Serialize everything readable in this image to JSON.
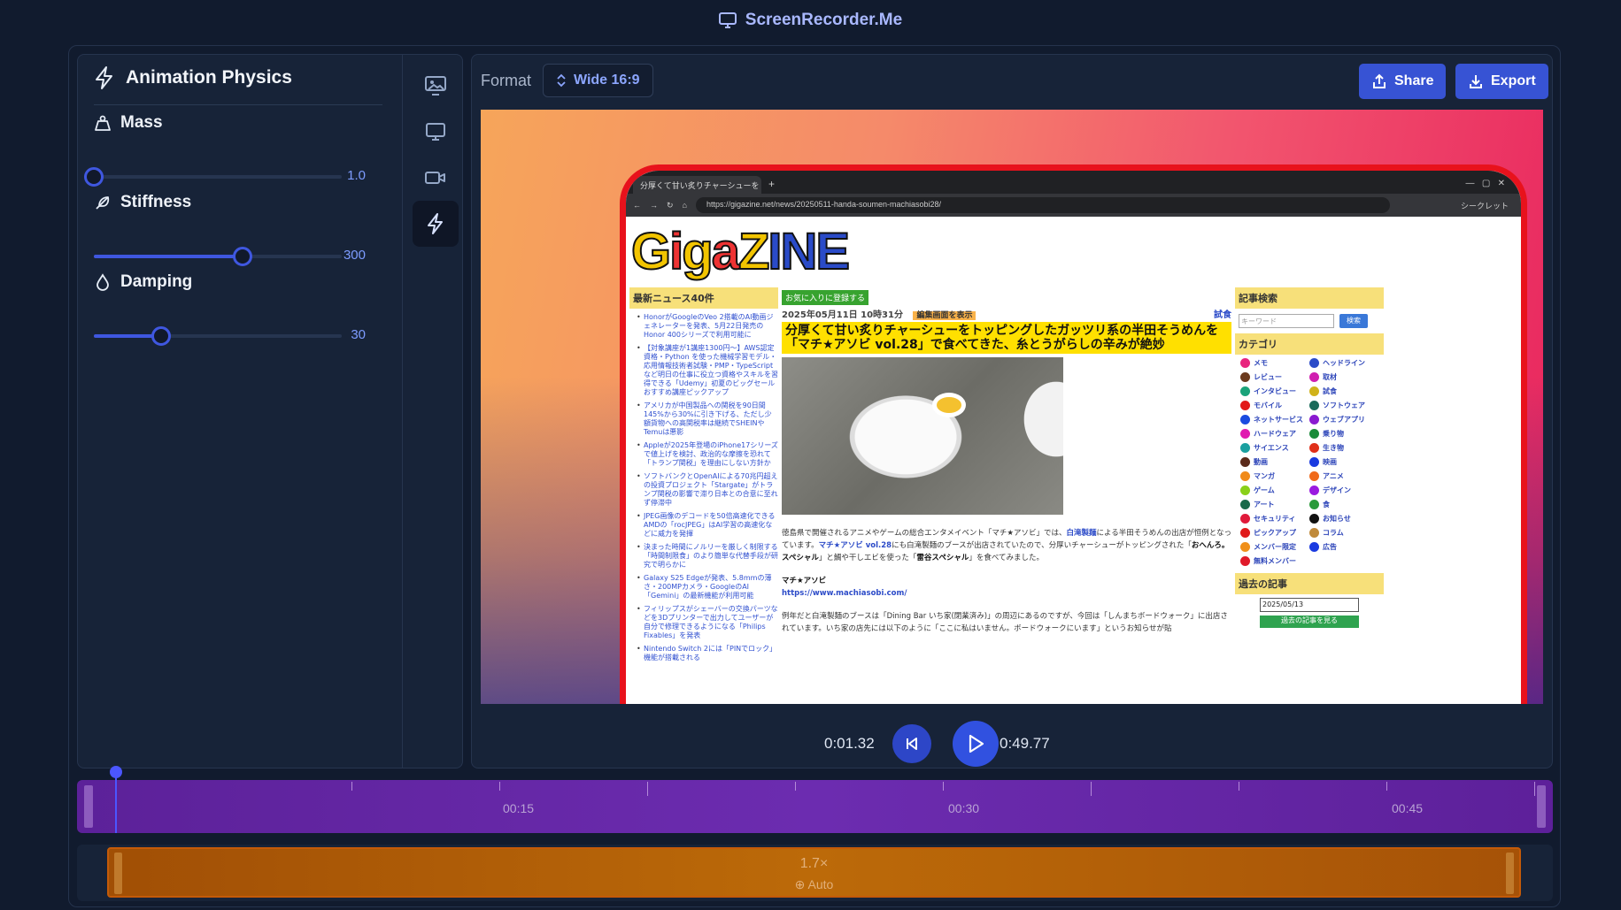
{
  "app": {
    "title": "ScreenRecorder.Me"
  },
  "left_panel": {
    "title": "Animation Physics",
    "params": [
      {
        "label": "Mass",
        "value": "1.0",
        "fraction": 0.0
      },
      {
        "label": "Stiffness",
        "value": "300",
        "fraction": 0.6
      },
      {
        "label": "Damping",
        "value": "30",
        "fraction": 0.27
      }
    ]
  },
  "rail": {
    "icons": [
      "image-settings-icon",
      "monitor-icon",
      "video-icon",
      "lightning-icon"
    ],
    "active": "lightning-icon"
  },
  "toolbar": {
    "format_label": "Format",
    "format_value": "Wide 16:9",
    "share_label": "Share",
    "export_label": "Export"
  },
  "browser": {
    "tab_title": "分厚くて甘い炙りチャーシューをトッピ",
    "url": "https://gigazine.net/news/20250511-handa-soumen-machiasobi28/",
    "incognito": "シークレット"
  },
  "site": {
    "logo": "GIGAZINE",
    "left_box": "最新ニュース40件",
    "news": [
      "HonorがGoogleのVeo 2搭載のAI動画ジェネレーターを発表、5月22日発売のHonor 400シリーズで利用可能に",
      "【対象講座が1講座1300円〜】AWS認定資格・Python を使った機械学習モデル・応用情報技術者試験・PMP・TypeScriptなど明日の仕事に役立つ資格やスキルを習得できる「Udemy」初夏のビッグセールおすすめ講座ピックアップ",
      "アメリカが中国製品への関税を90日間145%から30%に引き下げる、ただし少額貨物への高関税率は継続でSHEINやTemuは悪影",
      "Appleが2025年登場のiPhone17シリーズで値上げを検討、政治的な摩擦を恐れて「トランプ関税」を理由にしない方針か",
      "ソフトバンクとOpenAIによる70兆円超えの投資プロジェクト「Stargate」がトランプ関税の影響で滞り日本との合意に至れず停滞中",
      "JPEG画像のデコードを50倍高速化できるAMDの「rocJPEG」はAI学習の高速化などに威力を発揮",
      "決まった時間にノルリーを厳しく制限する「時間制限食」のより簡単な代替手段が研究で明らかに",
      "Galaxy S25 Edgeが発表、5.8mmの薄さ・200MPカメラ・GoogleのAI「Gemini」の最新機能が利用可能",
      "フィリップスがシェーバーの交換パーツなどを3Dプリンターで出力してユーザーが自分で修理できるようになる「Philips Fixables」を発表",
      "Nintendo Switch 2には「PINでロック」機能が搭載される"
    ],
    "fav_label": "お気に入りに登録する",
    "date": "2025年05月11日 10時31分",
    "edit_label": "編集画面を表示",
    "tag": "試食",
    "headline": "分厚くて甘い炙りチャーシューをトッピングしたガッツリ系の半田そうめんを「マチ★アソビ vol.28」で食べてきた、糸とうがらしの辛みが絶妙",
    "para1_a": "徳島県で開催されるアニメやゲームの総合エンタメイベント「マチ★アソビ」では、",
    "para1_link": "白滝製麺",
    "para1_b": "による半田そうめんの出店が恒例となっています。",
    "para1_link2": "マチ★アソビ vol.28",
    "para1_c": "にも白滝製麺のブースが出店されていたので、分厚いチャーシューがトッピングされた「",
    "para1_bold1": "おへんろ。スペシャル",
    "para1_d": "」と鯛や干しエビを使った「",
    "para1_bold2": "雷谷スペシャル",
    "para1_e": "」を食べてみました。",
    "site_name": "マチ★アソビ",
    "site_url": "https://www.machiasobi.com/",
    "para2": "例年だと白滝製麺のブースは「Dining Bar いち家(閉業済み)」の周辺にあるのですが、今回は「しんまちボードウォーク」に出店されています。いち家の店先には以下のように「ここに私はいません。ボードウォークにいます」というお知らせが貼",
    "search_title": "記事検索",
    "search_placeholder": "キーワード",
    "search_btn": "検索",
    "cat_title": "カテゴリ",
    "categories": [
      {
        "name": "メモ",
        "color": "#e8247e"
      },
      {
        "name": "ヘッドライン",
        "color": "#2b4bc8"
      },
      {
        "name": "レビュー",
        "color": "#6b3a1e"
      },
      {
        "name": "取材",
        "color": "#d01fb0"
      },
      {
        "name": "インタビュー",
        "color": "#1aa37a"
      },
      {
        "name": "試食",
        "color": "#d0b21a"
      },
      {
        "name": "モバイル",
        "color": "#e21a1a"
      },
      {
        "name": "ソフトウェア",
        "color": "#1a6a5a"
      },
      {
        "name": "ネットサービス",
        "color": "#1a4be0"
      },
      {
        "name": "ウェブアプリ",
        "color": "#8a1ad0"
      },
      {
        "name": "ハードウェア",
        "color": "#e01ab0"
      },
      {
        "name": "乗り物",
        "color": "#1a8a3a"
      },
      {
        "name": "サイエンス",
        "color": "#1aa0a0"
      },
      {
        "name": "生き物",
        "color": "#e0301a"
      },
      {
        "name": "動画",
        "color": "#5a2a1a"
      },
      {
        "name": "映画",
        "color": "#1a3ae0"
      },
      {
        "name": "マンガ",
        "color": "#f08a1a"
      },
      {
        "name": "アニメ",
        "color": "#f06a1a"
      },
      {
        "name": "ゲーム",
        "color": "#8ad01a"
      },
      {
        "name": "デザイン",
        "color": "#9a1ae0"
      },
      {
        "name": "アート",
        "color": "#1a6a4a"
      },
      {
        "name": "食",
        "color": "#2a9a3a"
      },
      {
        "name": "セキュリティ",
        "color": "#e01a3a"
      },
      {
        "name": "お知らせ",
        "color": "#111111"
      },
      {
        "name": "ピックアップ",
        "color": "#e01a1a"
      },
      {
        "name": "コラム",
        "color": "#c08a3a"
      },
      {
        "name": "メンバー限定",
        "color": "#f0901a"
      },
      {
        "name": "広告",
        "color": "#1a3ae0"
      },
      {
        "name": "無料メンバー",
        "color": "#e01a2a"
      }
    ],
    "past_title": "過去の記事",
    "past_date": "2025/05/13",
    "past_btn": "過去の記事を見る"
  },
  "player": {
    "current": "0:01.32",
    "total": "0:49.77"
  },
  "timeline": {
    "labels": [
      "00:15",
      "00:30",
      "00:45"
    ],
    "playhead_fraction": 0.026,
    "speed": "1.7×",
    "speed_mode": "Auto"
  },
  "colors": {
    "accent": "#3753d4",
    "clip_track": "#6c2cb0",
    "speed_track": "#bc6a09",
    "border_highlight": "#e8121c"
  }
}
